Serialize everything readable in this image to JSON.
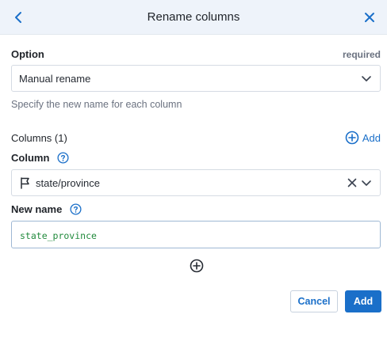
{
  "header": {
    "title": "Rename columns",
    "back_icon": "chevron-left-icon",
    "close_icon": "close-icon"
  },
  "option": {
    "label": "Option",
    "required_text": "required",
    "selected": "Manual rename",
    "hint": "Specify the new name for each column"
  },
  "columns": {
    "section_label": "Columns (1)",
    "add_label": "Add",
    "column_label": "Column",
    "column_value": "state/province",
    "new_name_label": "New name",
    "new_name_value": "state_province"
  },
  "footer": {
    "cancel_label": "Cancel",
    "add_label": "Add"
  },
  "colors": {
    "accent": "#1a6fc9",
    "header_bg": "#eef3fa",
    "code_text": "#218a3c"
  }
}
